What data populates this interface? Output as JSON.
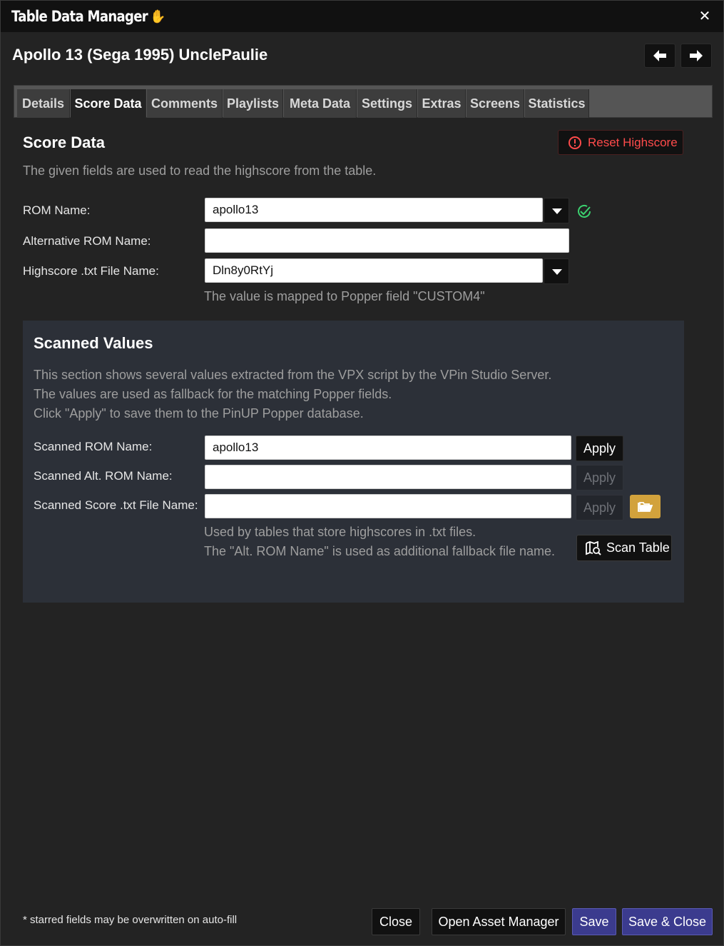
{
  "window": {
    "title": "Table Data Manager",
    "close_glyph": "✕"
  },
  "header": {
    "title": "Apollo 13 (Sega 1995) UnclePaulie",
    "prev_icon": "arrow-left-icon",
    "next_icon": "arrow-right-icon"
  },
  "tabs": [
    {
      "label": "Details",
      "active": false
    },
    {
      "label": "Score Data",
      "active": true
    },
    {
      "label": "Comments",
      "active": false
    },
    {
      "label": "Playlists",
      "active": false
    },
    {
      "label": "Meta Data",
      "active": false
    },
    {
      "label": "Settings",
      "active": false
    },
    {
      "label": "Extras",
      "active": false
    },
    {
      "label": "Screens",
      "active": false
    },
    {
      "label": "Statistics",
      "active": false
    }
  ],
  "score_data": {
    "title": "Score Data",
    "description": "The given fields are used to read the highscore from the table.",
    "reset_button": "Reset Highscore",
    "rom_name_label": "ROM Name:",
    "rom_name_value": "apollo13",
    "alt_rom_label": "Alternative ROM Name:",
    "alt_rom_value": "",
    "highscore_label": "Highscore .txt File Name:",
    "highscore_value": "Dln8y0RtYj",
    "mapping_note": "The value is mapped to Popper field \"CUSTOM4\""
  },
  "scanned": {
    "title": "Scanned Values",
    "desc_line1": "This section shows several values extracted from the VPX script by the VPin Studio Server.",
    "desc_line2": "The values are used as fallback for the matching Popper fields.",
    "desc_line3": "Click \"Apply\" to save them to the PinUP Popper database.",
    "rom_label": "Scanned ROM Name:",
    "rom_value": "apollo13",
    "alt_rom_label": "Scanned Alt. ROM Name:",
    "alt_rom_value": "",
    "score_file_label": "Scanned Score .txt File Name:",
    "score_file_value": "",
    "apply_label": "Apply",
    "note_line1": "Used by tables that store highscores in .txt files.",
    "note_line2": "The \"Alt. ROM Name\" is used as additional fallback file name.",
    "scan_button": "Scan Table"
  },
  "footer": {
    "note": "* starred fields may be overwritten on auto-fill",
    "close": "Close",
    "open_asset_manager": "Open Asset Manager",
    "save": "Save",
    "save_close": "Save & Close"
  },
  "colors": {
    "accent_primary": "#3b3b8e",
    "danger": "#ff4b4b",
    "success": "#3bd16f",
    "folder": "#d2a23c"
  }
}
